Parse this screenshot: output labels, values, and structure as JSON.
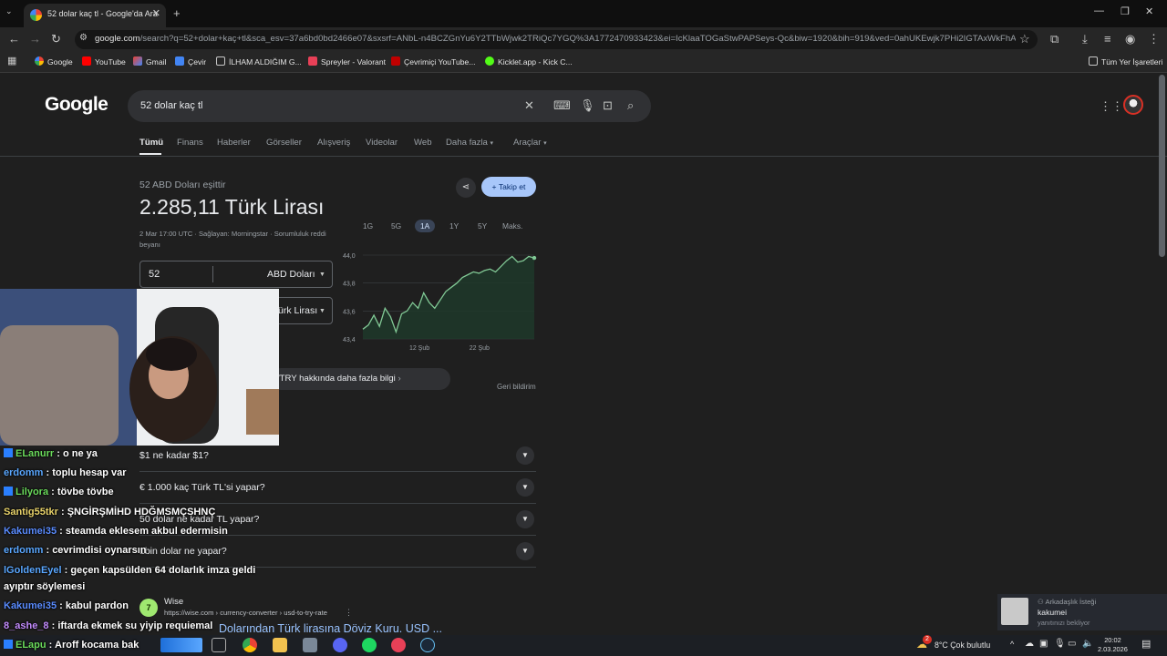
{
  "browser": {
    "tab_title": "52 dolar kaç tl - Google'da Ara",
    "tab_close": "✕",
    "new_tab": "+",
    "url_host": "google.com",
    "url_path": "/search?q=52+dolar+kaç+tl&sca_esv=37a6bd0bd2466e07&sxsrf=ANbL-n4BCZGnYu6Y2TTbWjwk2TRiQc7YGQ%3A1772470933423&ei=IcKlaaTOGaStwPAPSeys-Qc&biw=1920&bih=919&ved=0ahUKEwjk7PHi2IGTAxWkFhAIHWU2K...",
    "bookmarks": [
      "Google",
      "YouTube",
      "Gmail",
      "Çevir",
      "İLHAM ALDIĞIM G...",
      "Spreyler - Valorant",
      "Çevrimiçi YouTube...",
      "Kicklet.app - Kick C..."
    ],
    "all_bookmarks": "Tüm Yer İşaretleri"
  },
  "google": {
    "logo": "Google",
    "query": "52 dolar kaç tl",
    "tabs": [
      "Tümü",
      "Finans",
      "Haberler",
      "Görseller",
      "Alışveriş",
      "Videolar",
      "Web",
      "Daha fazla",
      "Araçlar"
    ]
  },
  "converter": {
    "subtitle": "52 ABD Doları eşittir",
    "result": "2.285,11 Türk Lirası",
    "meta": "2 Mar 17:00 UTC · Sağlayan: Morningstar · Sorumluluk reddi beyanı",
    "follow_label": "Takip et",
    "amount": "52",
    "from_currency": "ABD Doları",
    "to_currency_visible": "ürk Lirası",
    "ranges": [
      "1G",
      "5G",
      "1A",
      "1Y",
      "5Y",
      "Maks."
    ],
    "selected_range": "1A",
    "more_info": "/TRY hakkında daha fazla bilgi",
    "feedback": "Geri bildirim"
  },
  "chart_data": {
    "type": "line",
    "y_ticks": [
      "44,0",
      "43,8",
      "43,6",
      "43,4"
    ],
    "x_ticks": [
      "12 Şub",
      "22 Şub"
    ],
    "ylim": [
      43.4,
      44.0
    ],
    "values": [
      43.47,
      43.5,
      43.57,
      43.49,
      43.62,
      43.56,
      43.45,
      43.58,
      43.6,
      43.66,
      43.62,
      43.73,
      43.66,
      43.62,
      43.68,
      43.74,
      43.77,
      43.8,
      43.84,
      43.86,
      43.88,
      43.87,
      43.89,
      43.9,
      43.88,
      43.92,
      43.96,
      43.99,
      43.95,
      43.96,
      43.99,
      43.98
    ],
    "color": "#81c995",
    "fill": "#1e3a2a"
  },
  "paa": [
    "$1 ne kadar $1?",
    "€ 1.000 kaç Türk TL'si yapar?",
    "50 dolar ne kadar TL yapar?",
    "1bin dolar ne yapar?"
  ],
  "result": {
    "site": "Wise",
    "url": "https://wise.com › currency-converter › usd-to-try-rate",
    "title": "Dolarından Türk lirasına Döviz Kuru. USD ..."
  },
  "chat": [
    {
      "user": "ELanurr",
      "msg": "o ne ya",
      "color": "#6bdc5c",
      "badge": true
    },
    {
      "user": "erdomm",
      "msg": "toplu hesap var",
      "color": "#5aa7ff",
      "badge": false
    },
    {
      "user": "Lilyora",
      "msg": "tövbe tövbe",
      "color": "#6bdc5c",
      "badge": true
    },
    {
      "user": "Santig55tkr",
      "msg": "ŞNGİRŞMİHD HDĞMSMÇSHNÇ",
      "color": "#e8d26a",
      "badge": false
    },
    {
      "user": "Kakumei35",
      "msg": "steamda eklesem akbul edermisin",
      "color": "#5a8cff",
      "badge": false
    },
    {
      "user": "erdomm",
      "msg": "cevrimdisi oynarsın",
      "color": "#5aa7ff",
      "badge": false
    },
    {
      "user": "lGoldenEyel",
      "msg": "geçen kapsülden 64 dolarlık imza geldi",
      "color": "#5aa7ff",
      "badge": false
    },
    {
      "user": "",
      "msg": "ayıptır söylemesi",
      "color": "#ffffff",
      "badge": false
    },
    {
      "user": "Kakumei35",
      "msg": "kabul pardon",
      "color": "#5a8cff",
      "badge": false
    },
    {
      "user": "8_ashe_8",
      "msg": "iftarda ekmek su yiyip requiemal",
      "color": "#c48cff",
      "badge": false
    },
    {
      "user": "ELapu",
      "msg": "Aroff kocama bak",
      "color": "#6bdc5c",
      "badge": true
    }
  ],
  "notification": {
    "header": "Arkadaşlık İsteği",
    "name": "kakumei",
    "status": "yanıtınızı bekliyor"
  },
  "taskbar": {
    "weather": "8°C  Çok bulutlu",
    "weather_badge": "2",
    "time": "20:02",
    "date": "2.03.2026"
  }
}
